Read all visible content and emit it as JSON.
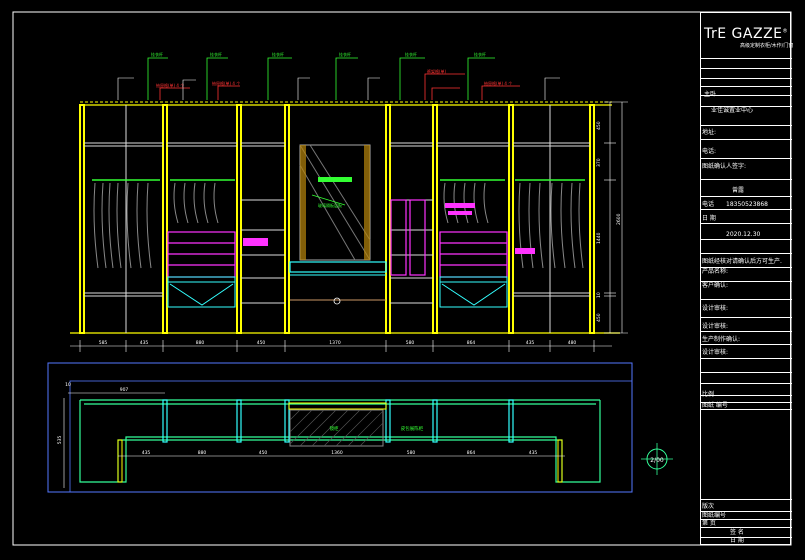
{
  "title_block": {
    "logo": "TrE GAZZE",
    "logo_mark": "®",
    "logo_sub": "高级定制衣柜/木作/门窗",
    "room": "主卧",
    "project": "业佳诚置业中心",
    "addr_label": "地址:",
    "tel_label": "电话:",
    "client_label": "图纸确认人签字:",
    "designer": "曾露",
    "phone_label": "电话",
    "phone": "18350523868",
    "date_label": "日  期",
    "date": "2020.12.30",
    "note": "图纸经核对请确认后方可生产.",
    "product_label": "产品名称:",
    "customer_label": "客户确认:",
    "sign1": "设计审核:",
    "sign2": "设计审核:",
    "sign3": "生产制作确认:",
    "sign4": "设计审核:",
    "scale_label": "比例",
    "sheet_label": "图纸 编号",
    "rev_label": "版次",
    "drawing_no": "图纸编号",
    "page_label": "第 页",
    "bottom1": "签   名",
    "bottom2": "签   字",
    "bottom3": "日  期"
  },
  "elevation": {
    "bottom_dims": [
      "585",
      "435",
      "880",
      "450",
      "1370",
      "580",
      "864",
      "435",
      "480"
    ],
    "right_dims": [
      "450",
      "370",
      "3300",
      "1440",
      "10",
      "450"
    ],
    "right_total": "2600",
    "dim_labels": [
      "15",
      "250",
      "250",
      "500",
      "15",
      "150",
      "175",
      "175",
      "50",
      "250",
      "250",
      "500",
      "821",
      "821"
    ],
    "notes_green": [
      "挂衣杆",
      "挂衣杆",
      "挂衣杆",
      "挂衣杆",
      "挂衣杆",
      "挂衣杆",
      "挂衣杆"
    ],
    "notes_red": [
      "抽屉格(单) 4 个",
      "抽屉格(单) 4 个",
      "裤架格(单)",
      "抽屉格(单) 4 个"
    ],
    "center_label": "玻璃隔板层板"
  },
  "plan": {
    "top_dim": "907",
    "left_dim": "535",
    "dims": [
      "435",
      "880",
      "450",
      "1360",
      "580",
      "864",
      "435"
    ],
    "small_dims": [
      "45",
      "45",
      "45",
      "45",
      "45",
      "45",
      "45",
      "45",
      "50",
      "50"
    ],
    "label_mirror": "镜柜",
    "label_island": "皮包展陈柜",
    "corner": "10"
  },
  "north": {
    "label": "2/00"
  }
}
